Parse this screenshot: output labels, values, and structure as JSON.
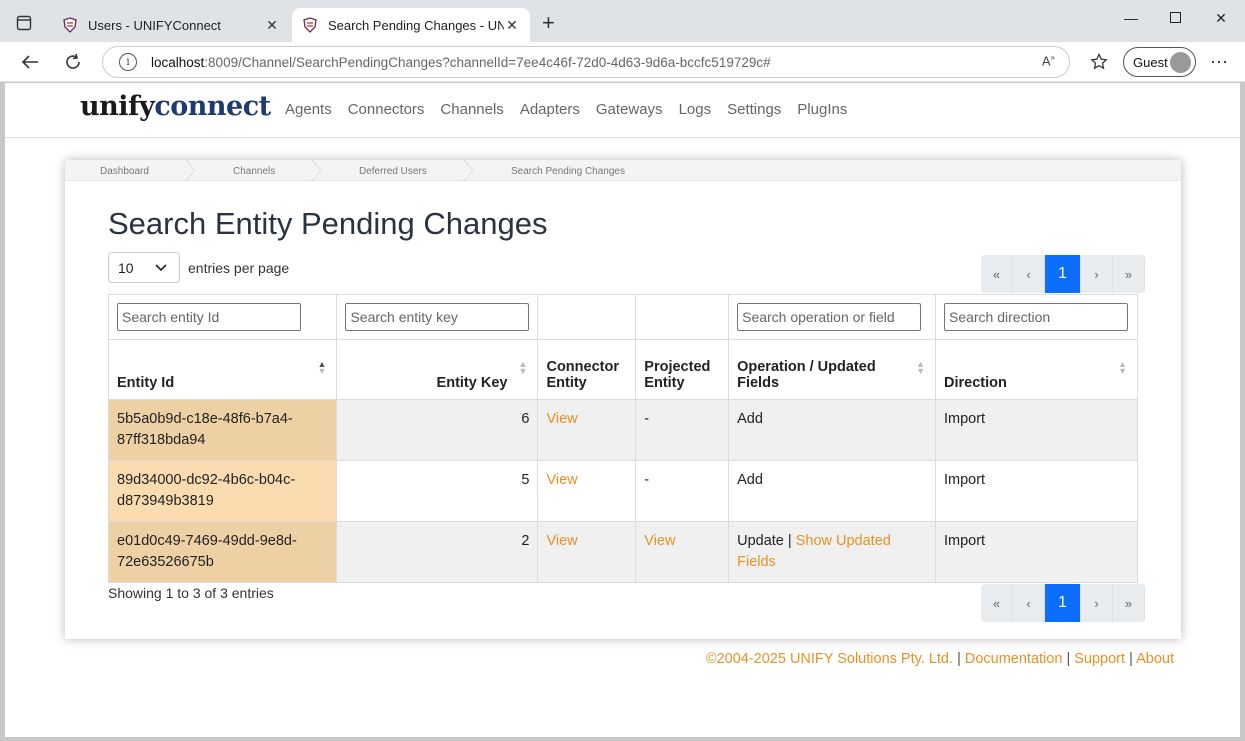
{
  "browser": {
    "tabs": [
      {
        "title": "Users - UNIFYConnect"
      },
      {
        "title": "Search Pending Changes - UNIFYC"
      }
    ],
    "url_host": "localhost",
    "url_rest": ":8009/Channel/SearchPendingChanges?channelId=7ee4c46f-72d0-4d63-9d6a-bccfc519729c#",
    "profile": "Guest"
  },
  "site": {
    "logo_a": "unify",
    "logo_b": "connect",
    "nav": [
      "Agents",
      "Connectors",
      "Channels",
      "Adapters",
      "Gateways",
      "Logs",
      "Settings",
      "PlugIns"
    ]
  },
  "breadcrumbs": [
    "Dashboard",
    "Channels",
    "Deferred Users",
    "Search Pending Changes"
  ],
  "page_title": "Search Entity Pending Changes",
  "length": {
    "value": "10",
    "label": "entries per page"
  },
  "pager": {
    "first": "«",
    "prev": "‹",
    "current": "1",
    "next": "›",
    "last": "»"
  },
  "filters": {
    "entity_id": "Search entity Id",
    "entity_key": "Search entity key",
    "operation": "Search operation or field",
    "direction": "Search direction"
  },
  "columns": {
    "entity_id": "Entity Id",
    "entity_key": "Entity Key",
    "connector_entity": "Connector Entity",
    "projected_entity": "Projected Entity",
    "operation": "Operation / Updated Fields",
    "direction": "Direction"
  },
  "rows": [
    {
      "entity_id": "5b5a0b9d-c18e-48f6-b7a4-87ff318bda94",
      "entity_key": "6",
      "connector": "View",
      "projected": "-",
      "operation": "Add",
      "updated_link": "",
      "direction": "Import"
    },
    {
      "entity_id": "89d34000-dc92-4b6c-b04c-d873949b3819",
      "entity_key": "5",
      "connector": "View",
      "projected": "-",
      "operation": "Add",
      "updated_link": "",
      "direction": "Import"
    },
    {
      "entity_id": "e01d0c49-7469-49dd-9e8d-72e63526675b",
      "entity_key": "2",
      "connector": "View",
      "projected": "View",
      "operation": "Update |",
      "updated_link": "Show Updated Fields",
      "direction": "Import"
    }
  ],
  "info": "Showing 1 to 3 of 3 entries",
  "footer": {
    "copyright": "©2004-2025 UNIFY Solutions Pty. Ltd.",
    "sep": "|",
    "documentation": "Documentation",
    "support": "Support",
    "about": "About"
  }
}
